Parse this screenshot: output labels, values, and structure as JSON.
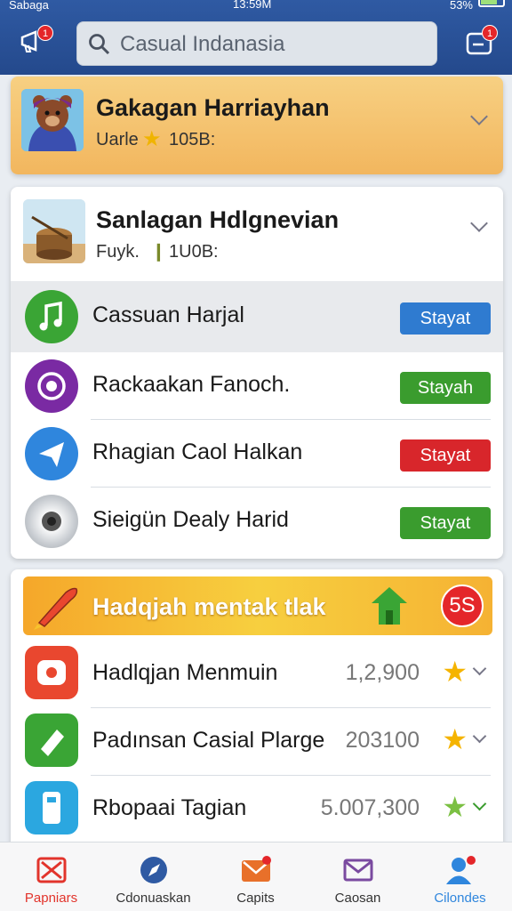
{
  "status_bar": {
    "carrier": "Sabaga",
    "time": "13:59M",
    "battery": "53%"
  },
  "header": {
    "search_text": "Casual Indanasia",
    "left_badge": "1",
    "right_badge": "1"
  },
  "featured": {
    "title": "Gakagan Harriayhan",
    "meta_prefix": "Uarle",
    "meta_value": "105B:"
  },
  "group": {
    "title": "Sanlagan Hdlgnevian",
    "meta_prefix": "Fuyk.",
    "meta_value": "1U0B:",
    "items": [
      {
        "label": "Cassuan Harjal",
        "button": "Stayat",
        "button_color": "#2f7bd0",
        "icon_color": "#3aa535"
      },
      {
        "label": "Rackaakan Fanoch.",
        "button": "Stayah",
        "button_color": "#3a9c2e",
        "icon_color": "#7a2aa3"
      },
      {
        "label": "Rhagian Caol Halkan",
        "button": "Stayat",
        "button_color": "#d8262b",
        "icon_color": "#2f86dd"
      },
      {
        "label": "Sieigün Dealy Harid",
        "button": "Stayat",
        "button_color": "#3a9c2e",
        "icon_color": "#9aa0a6"
      }
    ]
  },
  "ranking": {
    "banner": "Hadqjah mentak tlak",
    "banner_badge": "5S",
    "items": [
      {
        "label": "Hadlqjan Menmuin",
        "value": "1,2,900",
        "icon_color": "#e9472f"
      },
      {
        "label": "Padınsan Casial Plarge",
        "value": "203100",
        "icon_color": "#3aa535"
      },
      {
        "label": "Rbopaai Tagian",
        "value": "5.007,300",
        "icon_color": "#2ba7e0"
      }
    ]
  },
  "nav": [
    {
      "label": "Papniars",
      "color": "#e2342c"
    },
    {
      "label": "Cdonuaskan",
      "color": "#2f5aa3"
    },
    {
      "label": "Capits",
      "color": "#e8702a"
    },
    {
      "label": "Caosan",
      "color": "#7a4aa0"
    },
    {
      "label": "Cilondes",
      "color": "#2f86dd"
    }
  ],
  "colors": {
    "header": "#2f5aa3",
    "accent_gold": "#f5b233"
  }
}
